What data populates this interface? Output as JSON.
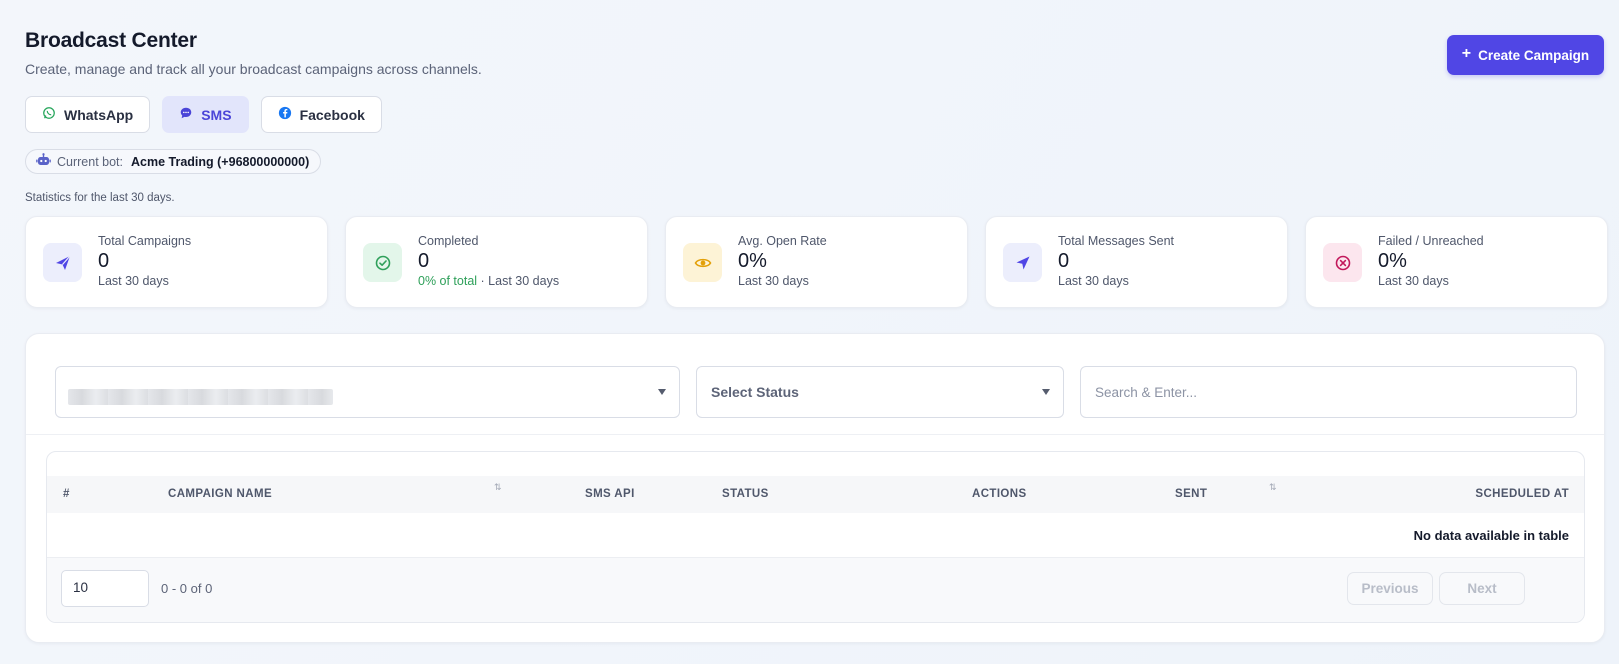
{
  "header": {
    "title": "Broadcast Center",
    "subtitle": "Create, manage and track all your broadcast campaigns across channels.",
    "create_label": "Create Campaign"
  },
  "channels": [
    {
      "label": "WhatsApp",
      "icon": "whatsapp-icon",
      "active": false
    },
    {
      "label": "SMS",
      "icon": "sms-icon",
      "active": true
    },
    {
      "label": "Facebook",
      "icon": "facebook-icon",
      "active": false
    }
  ],
  "bot": {
    "label": "Current bot:",
    "value": "Acme Trading (+96800000000)"
  },
  "stats_note": "Statistics for the last 30 days.",
  "stats": [
    {
      "label": "Total Campaigns",
      "value": "0",
      "sub": "Last 30 days",
      "icon": "send-icon",
      "color": "#5046e5",
      "bg": "#eceefc"
    },
    {
      "label": "Completed",
      "value": "0",
      "sub_green": "0% of total",
      "sub": " · Last 30 days",
      "icon": "check-circle-icon",
      "color": "#2fa05a",
      "bg": "#e3f6ea"
    },
    {
      "label": "Avg. Open Rate",
      "value": "0%",
      "sub": "Last 30 days",
      "icon": "eye-icon",
      "color": "#e3a008",
      "bg": "#fdf3d6"
    },
    {
      "label": "Total Messages Sent",
      "value": "0",
      "sub": "Last 30 days",
      "icon": "navigation-icon",
      "color": "#5046e5",
      "bg": "#eceefc"
    },
    {
      "label": "Failed / Unreached",
      "value": "0%",
      "sub": "Last 30 days",
      "icon": "x-circle-icon",
      "color": "#c2185b",
      "bg": "#fce6ee"
    }
  ],
  "filters": {
    "status_placeholder": "Select Status",
    "search_placeholder": "Search & Enter..."
  },
  "table": {
    "columns": [
      "#",
      "CAMPAIGN NAME",
      "SMS API",
      "STATUS",
      "ACTIONS",
      "SENT",
      "SCHEDULED AT"
    ],
    "empty_text": "No data available in table",
    "per_page": "10",
    "range": "0 - 0 of 0",
    "prev_label": "Previous",
    "next_label": "Next"
  }
}
